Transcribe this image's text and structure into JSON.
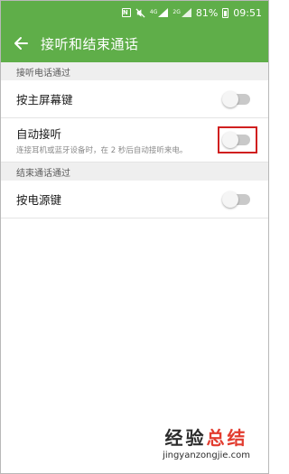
{
  "status_bar": {
    "nfc": "N",
    "network_4g": "4G",
    "network_2g": "2G",
    "battery": "81%",
    "time": "09:51"
  },
  "toolbar": {
    "title": "接听和结束通话"
  },
  "sections": [
    {
      "header": "接听电话通过",
      "items": [
        {
          "label": "按主屏幕键",
          "subtitle": "",
          "enabled": false
        },
        {
          "label": "自动接听",
          "subtitle": "连接耳机或蓝牙设备时，在 2 秒后自动接听来电。",
          "enabled": false
        }
      ]
    },
    {
      "header": "结束通话通过",
      "items": [
        {
          "label": "按电源键",
          "subtitle": "",
          "enabled": false
        }
      ]
    }
  ],
  "watermark": {
    "part1": "经验",
    "part2": "总结",
    "url": "jingyanzongjie.com"
  },
  "colors": {
    "accent": "#5fae49",
    "highlight": "#d01f1f"
  },
  "icons": {
    "back": "arrow-left-icon"
  }
}
